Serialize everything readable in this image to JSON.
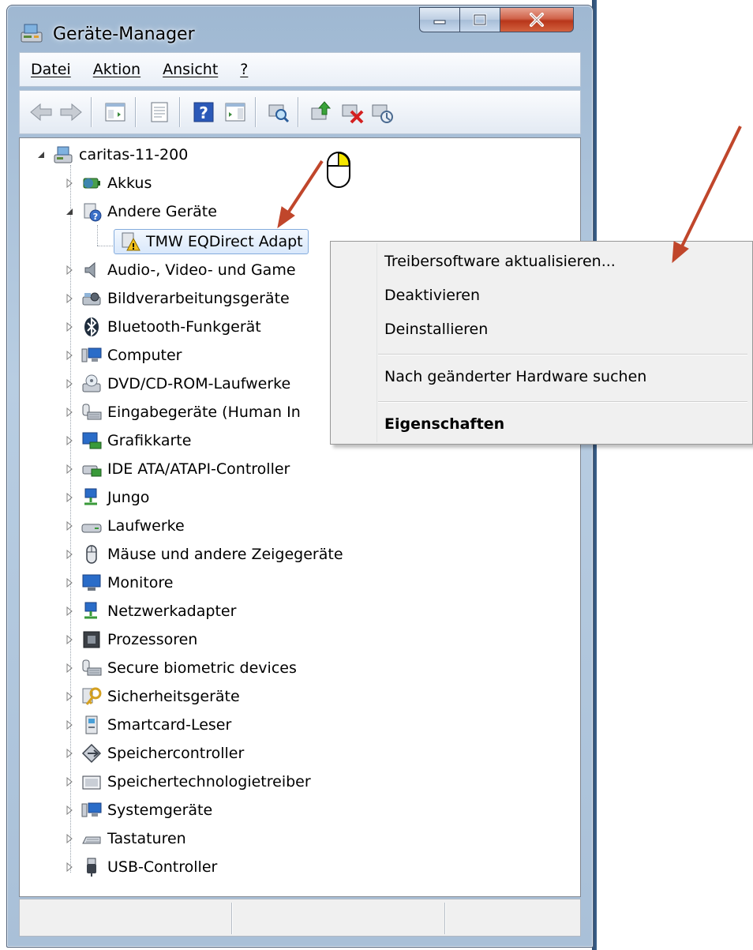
{
  "window": {
    "title": "Geräte-Manager"
  },
  "menu": {
    "file": "Datei",
    "action": "Aktion",
    "view": "Ansicht",
    "help": "?"
  },
  "toolbar": {
    "buttons": [
      "back-icon",
      "forward-icon",
      "console-tree-icon",
      "properties-icon",
      "help-icon",
      "action-pane-icon",
      "scan-hardware-icon",
      "update-driver-icon",
      "uninstall-icon",
      "disable-icon"
    ]
  },
  "tree": {
    "root": "caritas-11-200",
    "items": [
      {
        "label": "Akkus"
      },
      {
        "label": "Andere Geräte"
      },
      {
        "label": "TMW EQDirect Adapt"
      },
      {
        "label": "Audio-, Video- und Game"
      },
      {
        "label": "Bildverarbeitungsgeräte"
      },
      {
        "label": "Bluetooth-Funkgerät"
      },
      {
        "label": "Computer"
      },
      {
        "label": "DVD/CD-ROM-Laufwerke"
      },
      {
        "label": "Eingabegeräte (Human In"
      },
      {
        "label": "Grafikkarte"
      },
      {
        "label": "IDE ATA/ATAPI-Controller"
      },
      {
        "label": "Jungo"
      },
      {
        "label": "Laufwerke"
      },
      {
        "label": "Mäuse und andere Zeigegeräte"
      },
      {
        "label": "Monitore"
      },
      {
        "label": "Netzwerkadapter"
      },
      {
        "label": "Prozessoren"
      },
      {
        "label": "Secure biometric devices"
      },
      {
        "label": "Sicherheitsgeräte"
      },
      {
        "label": "Smartcard-Leser"
      },
      {
        "label": "Speichercontroller"
      },
      {
        "label": "Speichertechnologietreiber"
      },
      {
        "label": "Systemgeräte"
      },
      {
        "label": "Tastaturen"
      },
      {
        "label": "USB-Controller"
      }
    ]
  },
  "context_menu": {
    "update_driver": "Treibersoftware aktualisieren...",
    "disable": "Deaktivieren",
    "uninstall": "Deinstallieren",
    "scan": "Nach geänderter Hardware suchen",
    "properties": "Eigenschaften"
  },
  "colors": {
    "annotation_arrow": "#c0462b",
    "selection_border": "#84acdd"
  }
}
